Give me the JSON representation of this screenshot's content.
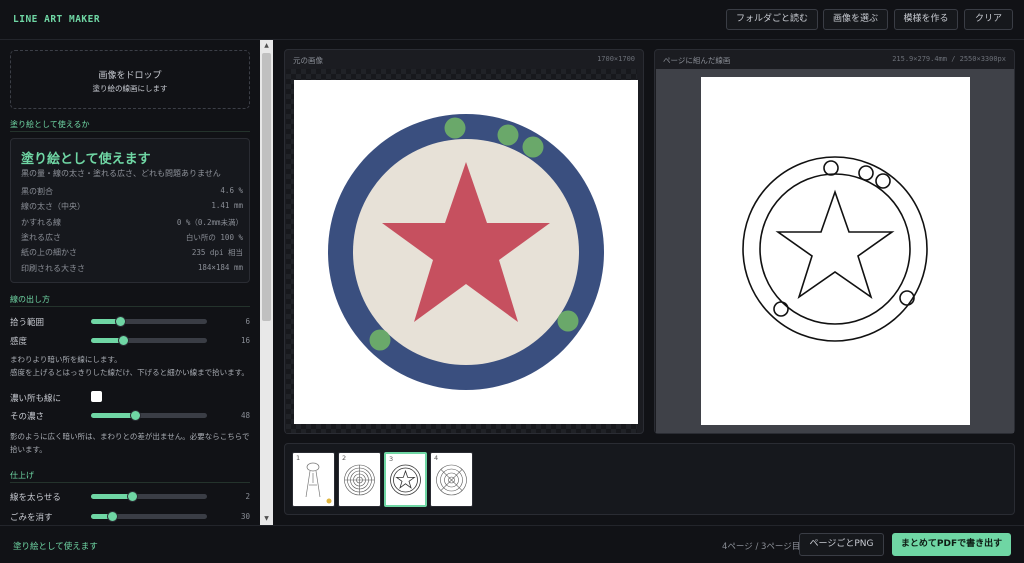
{
  "app": {
    "title": "LINE ART MAKER"
  },
  "header": {
    "buttons": [
      {
        "label": "フォルダごと読む"
      },
      {
        "label": "画像を選ぶ"
      },
      {
        "label": "模様を作る"
      },
      {
        "label": "クリア"
      }
    ]
  },
  "dropzone": {
    "title": "画像をドロップ",
    "subtitle": "塗り絵の線画にします"
  },
  "assessment": {
    "section_title": "塗り絵として使えるか",
    "verdict": "塗り絵として使えます",
    "verdict_sub": "黒の量・線の太さ・塗れる広さ、どれも問題ありません",
    "stats": [
      {
        "label": "黒の割合",
        "value": "4.6 %"
      },
      {
        "label": "線の太さ（中央）",
        "value": "1.41 mm"
      },
      {
        "label": "かすれる線",
        "value": "0 %（0.2mm未満）"
      },
      {
        "label": "塗れる広さ",
        "value": "白い所の 100 %"
      },
      {
        "label": "紙の上の細かさ",
        "value": "235 dpi 相当"
      },
      {
        "label": "印刷される大きさ",
        "value": "184×184 mm"
      }
    ]
  },
  "line_controls": {
    "section_title": "線の出し方",
    "range": {
      "label": "拾う範囲",
      "value": 6,
      "level": 0.25
    },
    "sensitivity": {
      "label": "感度",
      "value": 16,
      "level": 0.28
    },
    "note1_bold": "まわりより暗い所を線にします。",
    "note1": "感度を上げるとはっきりした線だけ、下げると細かい線まで拾います。",
    "dark_as_line": {
      "label": "濃い所も線に",
      "checked": false
    },
    "density": {
      "label": "その濃さ",
      "value": 48,
      "level": 0.38
    },
    "note2": "影のように広く暗い所は、まわりとの差が出ません。必要ならこちらで拾います。"
  },
  "finish": {
    "section_title": "仕上げ",
    "thicken": {
      "label": "線を太らせる",
      "value": 2,
      "level": 0.35
    },
    "denoise": {
      "label": "ごみを消す",
      "value": 30,
      "level": 0.18
    }
  },
  "original_panel": {
    "title": "元の画像",
    "size": "1700×1700"
  },
  "page_panel": {
    "title": "ページに組んだ線画",
    "size": "215.9×279.4mm / 2550×3300px"
  },
  "thumbnails": [
    {
      "num": "1",
      "active": false
    },
    {
      "num": "2",
      "active": false
    },
    {
      "num": "3",
      "active": true
    },
    {
      "num": "4",
      "active": false
    }
  ],
  "colors": {
    "accent": "#6fd6a4",
    "ring": "#3a4f7f",
    "disc": "#e7e1d7",
    "star": "#c6505f",
    "dots": "#6aa86a"
  },
  "footer": {
    "status": "塗り絵として使えます",
    "pages": "4ページ / 3ページ目",
    "png_button": "ページごとPNG",
    "pdf_button": "まとめてPDFで書き出す"
  }
}
